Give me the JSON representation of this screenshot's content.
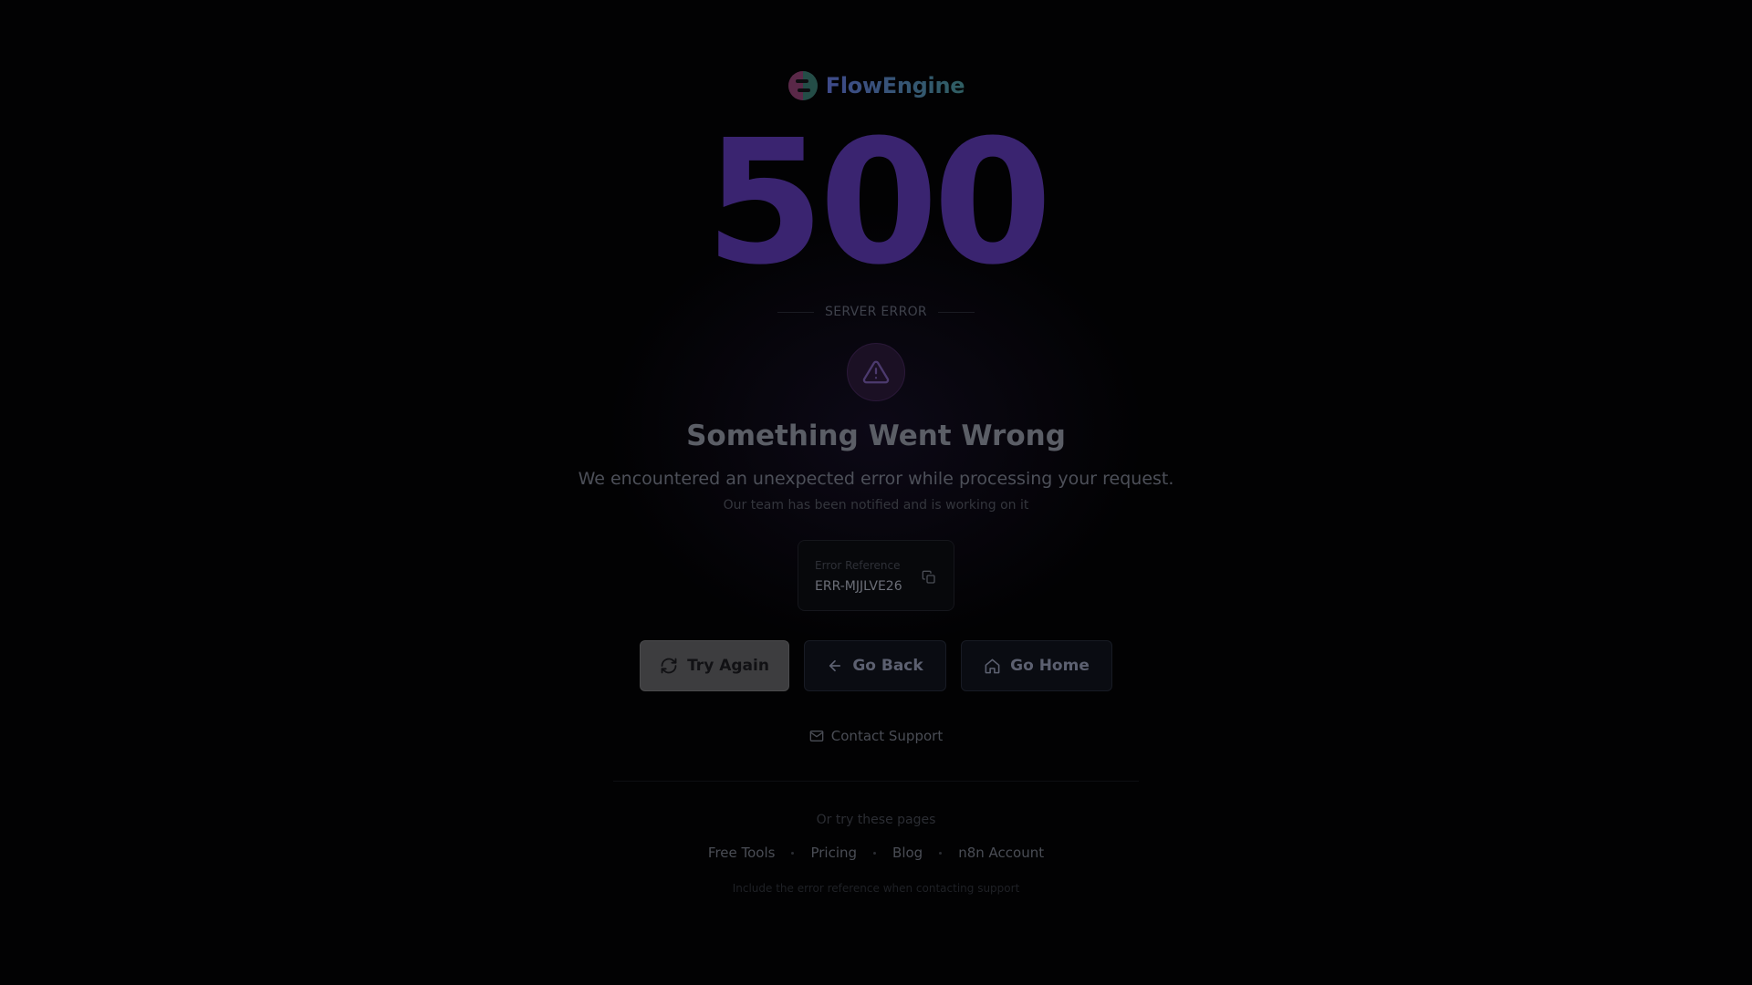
{
  "brand": {
    "name": "FlowEngine",
    "colors": {
      "logo_left": "#6a2e58",
      "logo_right": "#2f6a5a",
      "text_start": "#3e4a8a",
      "text_end": "#2f5e62"
    }
  },
  "error": {
    "code": "500",
    "kind": "SERVER ERROR",
    "icon": "warning-triangle-icon",
    "headline": "Something Went Wrong",
    "message": "We encountered an unexpected error while processing your request.",
    "submessage": "Our team has been notified and is working on it",
    "code_color": "#3a2470"
  },
  "reference": {
    "label": "Error Reference",
    "value": "ERR-MJJLVE26",
    "copy_icon": "copy-icon"
  },
  "actions": {
    "try_again": {
      "label": "Try Again",
      "icon": "refresh-icon"
    },
    "go_back": {
      "label": "Go Back",
      "icon": "arrow-left-icon"
    },
    "go_home": {
      "label": "Go Home",
      "icon": "home-icon"
    }
  },
  "support": {
    "label": "Contact Support",
    "icon": "mail-icon"
  },
  "alternatives": {
    "heading": "Or try these pages",
    "links": [
      "Free Tools",
      "Pricing",
      "Blog",
      "n8n Account"
    ]
  },
  "footnote": "Include the error reference when contacting support"
}
